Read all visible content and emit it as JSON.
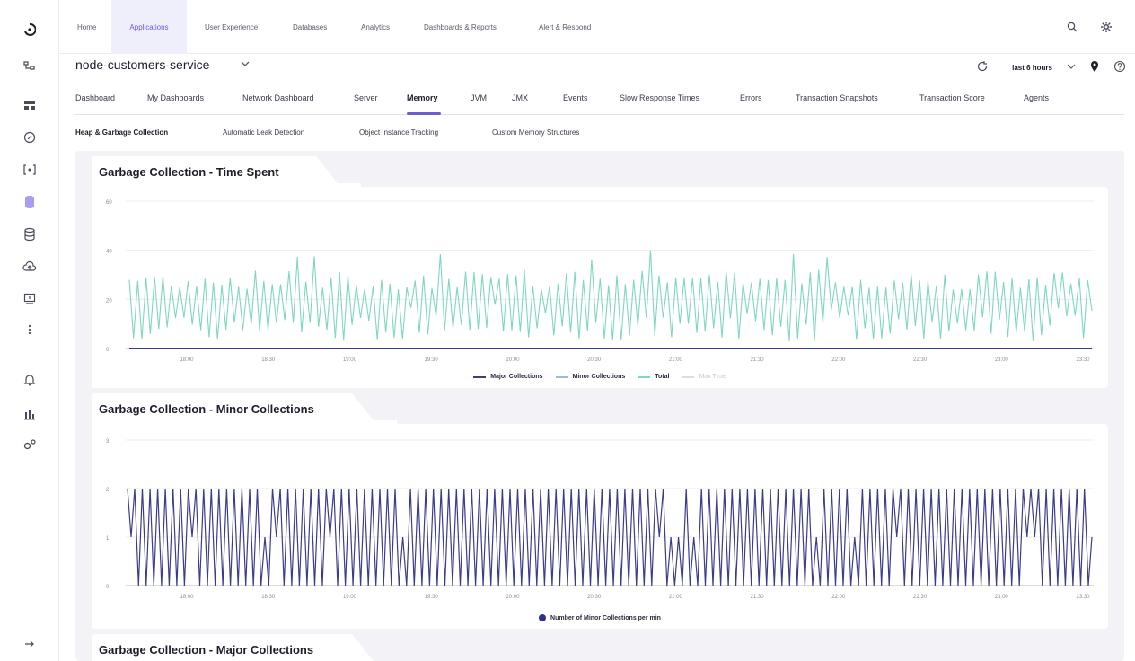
{
  "topnav": {
    "items": [
      "Home",
      "Applications",
      "User Experience",
      "Databases",
      "Analytics",
      "Dashboards & Reports",
      "Alert & Respond"
    ],
    "active": "Applications"
  },
  "service": {
    "name": "node-customers-service",
    "time_range": "last 6 hours"
  },
  "tabs": [
    "Dashboard",
    "My Dashboards",
    "Network Dashboard",
    "Server",
    "Memory",
    "JVM",
    "JMX",
    "Events",
    "Slow Response Times",
    "Errors",
    "Transaction Snapshots",
    "Transaction Score",
    "Agents"
  ],
  "active_tab": "Memory",
  "subtabs": [
    "Heap & Garbage Collection",
    "Automatic Leak Detection",
    "Object Instance Tracking",
    "Custom Memory Structures"
  ],
  "active_subtab": "Heap & Garbage Collection",
  "icons": {
    "logo": "app-logo-icon",
    "rail": [
      "topology-icon",
      "dashboard-icon",
      "gauge-icon",
      "bracket-icon",
      "database-active-icon",
      "storage-icon",
      "cloud-icon",
      "monitor-icon",
      "more-vertical-icon",
      "alert-bell-icon",
      "bar-chart-icon",
      "settings-gears-icon"
    ],
    "expand": "arrow-right-icon"
  },
  "colors": {
    "accent": "#6b5fd0",
    "teal": "#7fd6c4",
    "navy": "#3b3c8c",
    "minor_line": "#4a4a9a"
  },
  "panels": [
    {
      "title": "Garbage Collection - Time Spent",
      "legend": [
        "Major Collections",
        "Minor Collections",
        "Total",
        "Max Time"
      ]
    },
    {
      "title": "Garbage Collection - Minor Collections",
      "legend": [
        "Number of Minor Collections per min"
      ]
    },
    {
      "title": "Garbage Collection - Major Collections"
    }
  ],
  "chart_data": [
    {
      "type": "line",
      "title": "Garbage Collection - Time Spent",
      "x_ticks": [
        "18:00",
        "18:30",
        "19:00",
        "19:30",
        "20:00",
        "20:30",
        "21:00",
        "21:30",
        "22:00",
        "22:30",
        "23:00",
        "23:30"
      ],
      "y_ticks": [
        "0",
        "20",
        "40",
        "60"
      ],
      "ylim": [
        0,
        60
      ],
      "series": [
        {
          "name": "Major Collections",
          "color": "#3b3c8c",
          "values": [
            0
          ]
        },
        {
          "name": "Minor Collections",
          "color": "#9fb8e0",
          "values": [
            0
          ]
        },
        {
          "name": "Total",
          "color": "#7fd6c4",
          "peak_max": 40,
          "typical_peak": 28,
          "typical_low": 3
        },
        {
          "name": "Max Time",
          "color": "#dcdce4"
        }
      ]
    },
    {
      "type": "line",
      "title": "Garbage Collection - Minor Collections",
      "x_ticks": [
        "18:00",
        "18:30",
        "19:00",
        "19:30",
        "20:00",
        "20:30",
        "21:00",
        "21:30",
        "22:00",
        "22:30",
        "23:00",
        "23:30"
      ],
      "y_ticks": [
        "0",
        "1",
        "2",
        "3"
      ],
      "ylim": [
        0,
        3
      ],
      "series": [
        {
          "name": "Number of Minor Collections per min",
          "color": "#3b3c8c",
          "min": 0,
          "max": 2,
          "plateau": 1
        }
      ]
    }
  ]
}
